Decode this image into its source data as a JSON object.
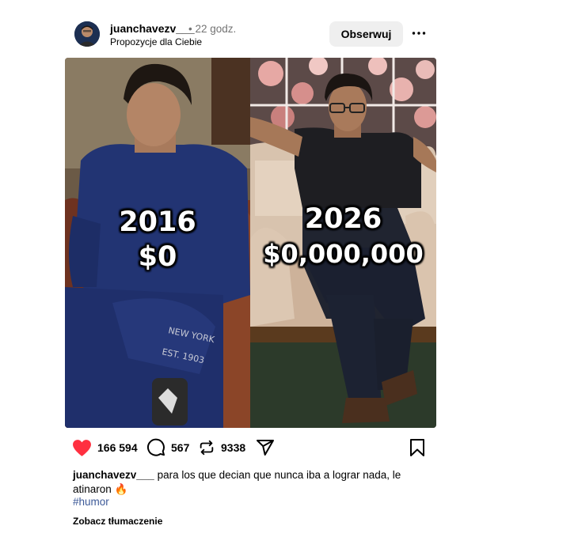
{
  "post": {
    "username": "juanchavezv___",
    "time": "• 22 godz.",
    "suggestion": "Propozycje dla Ciebie",
    "follow_label": "Obserwuj"
  },
  "media": {
    "left_year": "2016",
    "left_money": "$0",
    "right_year": "2026",
    "right_money": "$0,000,000"
  },
  "actions": {
    "likes": "166 594",
    "comments": "567",
    "reposts": "9338",
    "icons": [
      "heart-icon",
      "comment-icon",
      "repost-icon",
      "share-icon",
      "bookmark-icon"
    ],
    "like_color": "#ff3040"
  },
  "caption": {
    "username": "juanchavezv___",
    "text": "para los que decian que nunca iba a lograr nada, le atinaron 🔥",
    "hashtag": "#humor",
    "translate_label": "Zobacz tłumaczenie"
  }
}
